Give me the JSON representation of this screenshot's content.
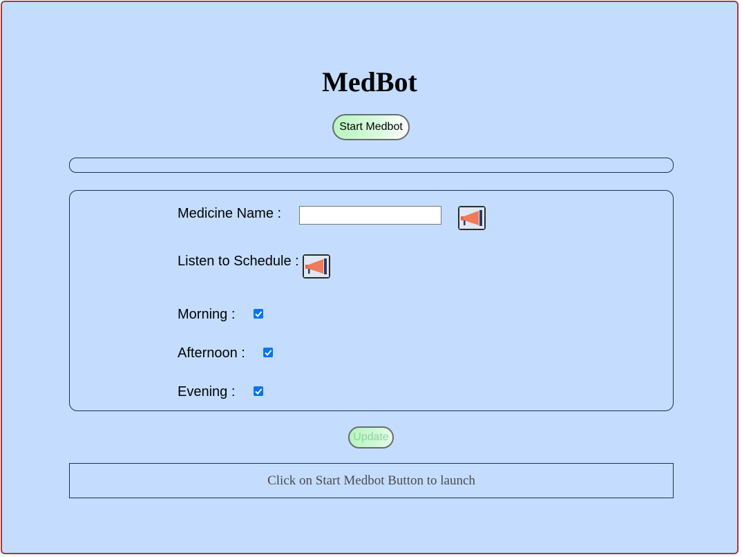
{
  "app": {
    "title": "MedBot",
    "start_button_label": "Start Medbot"
  },
  "progress": {
    "value": 0
  },
  "form": {
    "medicine_name_label": "Medicine Name :",
    "medicine_name_value": "",
    "medicine_name_placeholder": "",
    "speak_medicine_icon": "megaphone-icon",
    "listen_schedule_label": "Listen to Schedule :",
    "speak_schedule_icon": "megaphone-icon",
    "morning_label": "Morning :",
    "morning_checked": true,
    "afternoon_label": "Afternoon :",
    "afternoon_checked": true,
    "evening_label": "Evening :",
    "evening_checked": true
  },
  "update_button_label": "Update",
  "status_message": "Click on Start Medbot Button to launch",
  "colors": {
    "background": "#c4ddff",
    "frame_border": "#a33a3a",
    "button_green": "#b8f5c0",
    "checkbox_blue": "#0a74ea",
    "megaphone": "#f07a5a"
  }
}
